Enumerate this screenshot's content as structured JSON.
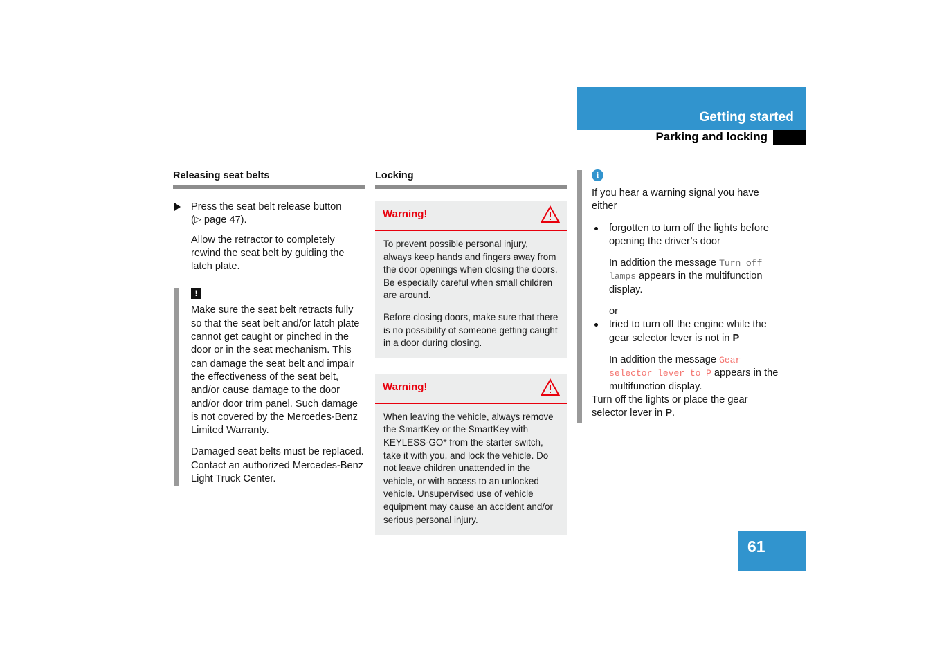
{
  "header": {
    "chapter": "Getting started",
    "section": "Parking and locking",
    "band_color": "#3194ce",
    "tab_color": "#000000"
  },
  "page_number": "61",
  "columns": {
    "left": {
      "heading": "Releasing seat belts",
      "step": {
        "marker": "solid-triangle-right",
        "line1": "Press the seat belt release button",
        "line2_prefix": "(",
        "line2_xref_icon": "▷",
        "line2_xref": " page 47).",
        "follow_up": "Allow the retractor to completely rewind the seat belt by guiding the latch plate."
      },
      "note": {
        "icon": "exclamation-icon",
        "icon_glyph": "!",
        "paragraphs": [
          "Make sure the seat belt retracts fully so that the seat belt and/or latch plate cannot get caught or pinched in the door or in the seat mechanism. This can damage the seat belt and impair the effectiveness of the seat belt, and/or cause damage to the door and/or door trim panel. Such damage is not covered by the Mercedes-Benz Limited Warranty.",
          "Damaged seat belts must be replaced. Contact an authorized Mercedes-Benz Light Truck Center."
        ]
      }
    },
    "middle": {
      "heading": "Locking",
      "warnings": [
        {
          "title": "Warning!",
          "icon": "warning-triangle-icon",
          "paragraphs": [
            "To prevent possible personal injury, always keep hands and fingers away from the door openings when closing the doors. Be especially careful when small children are around.",
            "Before closing doors, make sure that there is no possibility of someone getting caught in a door during closing."
          ]
        },
        {
          "title": "Warning!",
          "icon": "warning-triangle-icon",
          "paragraphs": [
            "When leaving the vehicle, always remove the SmartKey or the SmartKey with KEYLESS-GO* from the starter switch, take it with you, and lock the vehicle. Do not leave children unattended in the vehicle, or with access to an unlocked vehicle. Unsupervised use of vehicle equipment may cause an accident and/or serious personal injury."
          ]
        }
      ]
    },
    "right": {
      "icon": "info-icon",
      "icon_glyph": "i",
      "intro": "If you hear a warning signal you have either",
      "bullets": [
        {
          "text": "forgotten to turn off the lights before opening the driver’s door",
          "detail_prefix": "In addition the message ",
          "detail_code": "Turn off lamps",
          "detail_code_style": "mono-gray",
          "detail_suffix": " appears in the multifunction display.",
          "connector": "or"
        },
        {
          "text_pre": "tried to turn off the engine while the gear selector lever is not in ",
          "text_bold": "P",
          "detail_prefix": "In addition the message ",
          "detail_code": "Gear selector lever to P",
          "detail_code_style": "mono-red",
          "detail_suffix": " appears in the multifunction display."
        }
      ],
      "closing_pre": "Turn off the lights or place the gear selector lever in ",
      "closing_bold": "P",
      "closing_post": "."
    }
  }
}
